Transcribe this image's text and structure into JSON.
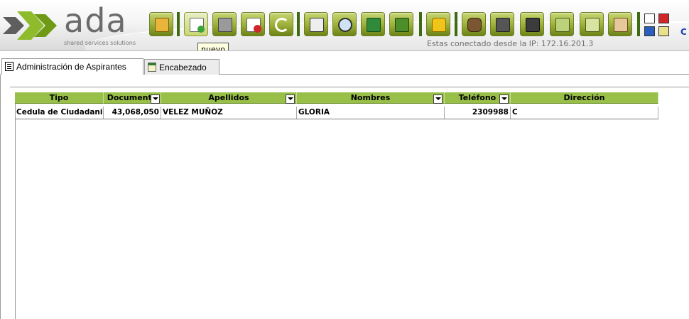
{
  "app": {
    "logo_text": "ada",
    "logo_tagline": "shared services solutions",
    "ip_message": "Estas conectado desde la IP: 172.16.201.3",
    "tooltip": "nuevo",
    "partial_link": "C"
  },
  "toolbar": {
    "buttons": [
      {
        "icon": "folder-open-icon"
      },
      {
        "icon": "new-document-icon"
      },
      {
        "icon": "save-disk-icon"
      },
      {
        "icon": "delete-icon"
      },
      {
        "icon": "undo-icon"
      },
      {
        "icon": "print-icon"
      },
      {
        "icon": "search-magnifier-icon"
      },
      {
        "icon": "excel-export-icon"
      },
      {
        "icon": "briefcase-icon"
      },
      {
        "icon": "lock-icon"
      },
      {
        "icon": "money-bag-icon"
      },
      {
        "icon": "camera-icon"
      },
      {
        "icon": "grid-windows-icon"
      },
      {
        "icon": "cart-icon"
      },
      {
        "icon": "edit-pencil-icon"
      },
      {
        "icon": "users-icon"
      }
    ]
  },
  "tabs": [
    {
      "label": "Administración de Aspirantes",
      "active": true
    },
    {
      "label": "Encabezado",
      "active": false
    }
  ],
  "grid": {
    "columns": [
      "Tipo",
      "Documento",
      "Apellidos",
      "Nombres",
      "Teléfono",
      "Dirección"
    ],
    "rows": [
      {
        "tipo": "Cedula de Ciudadania",
        "documento": "43,068,050",
        "apellidos": "VELEZ MUÑOZ",
        "nombres": "GLORIA",
        "telefono": "2309988",
        "direccion": "C"
      }
    ]
  },
  "colors": {
    "header_green": "#98c049",
    "toolbar_green": "#9fb23b",
    "separator_green": "#3e6b10",
    "link_blue": "#1a3fb5"
  }
}
